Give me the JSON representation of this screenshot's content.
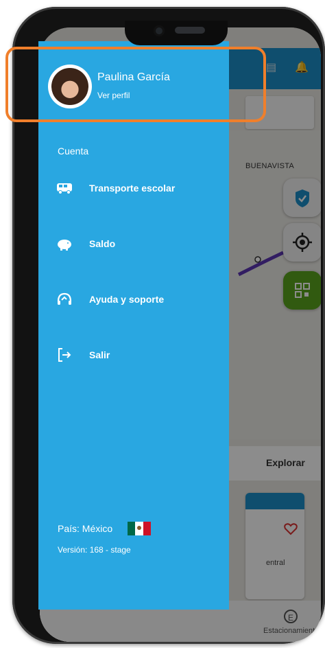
{
  "drawer": {
    "user_name": "Paulina García",
    "profile_link": "Ver perfil",
    "section_label": "Cuenta",
    "items": [
      {
        "label": "Transporte escolar",
        "icon": "bus-icon"
      },
      {
        "label": "Saldo",
        "icon": "piggy-bank-icon"
      },
      {
        "label": "Ayuda y soporte",
        "icon": "support-headset-icon"
      },
      {
        "label": "Salir",
        "icon": "logout-icon"
      }
    ],
    "country": "País: México",
    "version": "Versión: 168 - stage"
  },
  "background": {
    "map_label": "BUENAVISTA",
    "tab_label": "Explorar",
    "card_text": "entral",
    "bottom_nav_label": "Estacionamientos",
    "bottom_nav_icon_letter": "E"
  },
  "colors": {
    "drawer": "#29a7e1",
    "highlight": "#f07f2b",
    "fab_green": "#5aa51e"
  }
}
